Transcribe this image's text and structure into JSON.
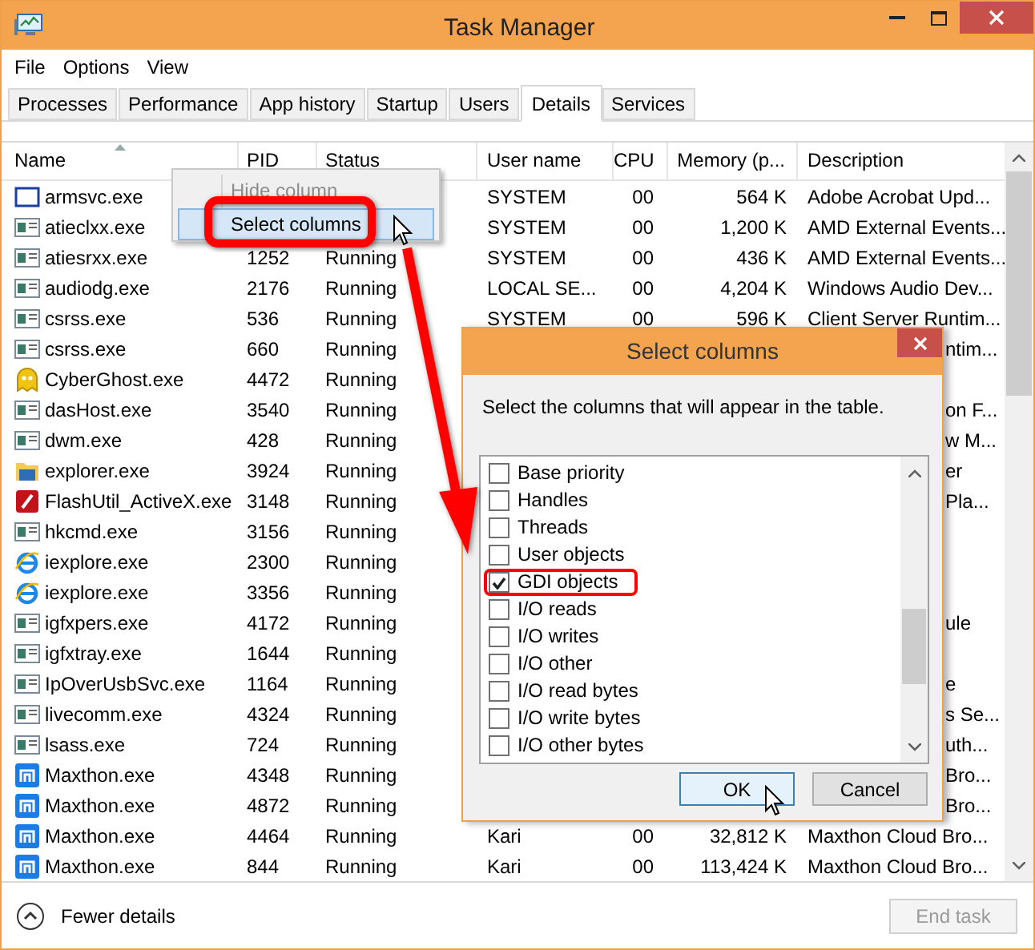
{
  "window": {
    "title": "Task Manager"
  },
  "menu": [
    "File",
    "Options",
    "View"
  ],
  "tabs": [
    {
      "label": "Processes",
      "selected": false
    },
    {
      "label": "Performance",
      "selected": false
    },
    {
      "label": "App history",
      "selected": false
    },
    {
      "label": "Startup",
      "selected": false
    },
    {
      "label": "Users",
      "selected": false
    },
    {
      "label": "Details",
      "selected": true
    },
    {
      "label": "Services",
      "selected": false
    }
  ],
  "table": {
    "columns": [
      {
        "label": "Name",
        "sorted": true
      },
      {
        "label": "PID",
        "sorted": false
      },
      {
        "label": "Status",
        "sorted": false
      },
      {
        "label": "User name",
        "sorted": false
      },
      {
        "label": "CPU",
        "sorted": false
      },
      {
        "label": "Memory (p...",
        "sorted": false
      },
      {
        "label": "Description",
        "sorted": false
      }
    ],
    "rows": [
      {
        "kind": "frame",
        "name": "armsvc.exe",
        "user": "SYSTEM",
        "cpu": "00",
        "memory": "564 K",
        "description": "Adobe Acrobat Upd..."
      },
      {
        "kind": "app",
        "name": "atieclxx.exe",
        "user": "SYSTEM",
        "cpu": "00",
        "memory": "1,200 K",
        "description": "AMD External Events..."
      },
      {
        "kind": "app",
        "name": "atiesrxx.exe",
        "pid": "1252",
        "status": "Running",
        "user": "SYSTEM",
        "cpu": "00",
        "memory": "436 K",
        "description": "AMD External Events..."
      },
      {
        "kind": "app",
        "name": "audiodg.exe",
        "pid": "2176",
        "status": "Running",
        "user": "LOCAL SE...",
        "cpu": "00",
        "memory": "4,204 K",
        "description": "Windows Audio Dev..."
      },
      {
        "kind": "app",
        "name": "csrss.exe",
        "pid": "536",
        "status": "Running",
        "user": "SYSTEM",
        "cpu": "00",
        "memory": "596 K",
        "description": "Client Server Runtim..."
      },
      {
        "kind": "app",
        "name": "csrss.exe",
        "pid": "660",
        "status": "Running",
        "description_tail": "ntim..."
      },
      {
        "kind": "ghost",
        "name": "CyberGhost.exe",
        "pid": "4472",
        "status": "Running"
      },
      {
        "kind": "app",
        "name": "dasHost.exe",
        "pid": "3540",
        "status": "Running",
        "description_tail": "on F..."
      },
      {
        "kind": "app",
        "name": "dwm.exe",
        "pid": "428",
        "status": "Running",
        "description_tail": "w M..."
      },
      {
        "kind": "folder",
        "name": "explorer.exe",
        "pid": "3924",
        "status": "Running",
        "description_tail": "er"
      },
      {
        "kind": "flash",
        "name": "FlashUtil_ActiveX.exe",
        "pid": "3148",
        "status": "Running",
        "description_tail": "Pla..."
      },
      {
        "kind": "app",
        "name": "hkcmd.exe",
        "pid": "3156",
        "status": "Running"
      },
      {
        "kind": "browser",
        "name": "iexplore.exe",
        "pid": "2300",
        "status": "Running"
      },
      {
        "kind": "browser",
        "name": "iexplore.exe",
        "pid": "3356",
        "status": "Running"
      },
      {
        "kind": "app",
        "name": "igfxpers.exe",
        "pid": "4172",
        "status": "Running",
        "description_tail": "ule"
      },
      {
        "kind": "app",
        "name": "igfxtray.exe",
        "pid": "1644",
        "status": "Running"
      },
      {
        "kind": "app",
        "name": "IpOverUsbSvc.exe",
        "pid": "1164",
        "status": "Running",
        "description_tail": "e"
      },
      {
        "kind": "app",
        "name": "livecomm.exe",
        "pid": "4324",
        "status": "Running",
        "description_tail": "s Se..."
      },
      {
        "kind": "app",
        "name": "lsass.exe",
        "pid": "724",
        "status": "Running",
        "description_tail": "uth..."
      },
      {
        "kind": "maxthon",
        "name": "Maxthon.exe",
        "pid": "4348",
        "status": "Running",
        "description_tail": "Bro..."
      },
      {
        "kind": "maxthon",
        "name": "Maxthon.exe",
        "pid": "4872",
        "status": "Running",
        "description_tail": "Bro..."
      },
      {
        "kind": "maxthon",
        "name": "Maxthon.exe",
        "pid": "4464",
        "status": "Running",
        "user": "Kari",
        "cpu": "00",
        "memory": "32,812 K",
        "description": "Maxthon Cloud Bro..."
      },
      {
        "kind": "maxthon",
        "name": "Maxthon.exe",
        "pid": "844",
        "status": "Running",
        "user": "Kari",
        "cpu": "00",
        "memory": "113,424 K",
        "description": "Maxthon Cloud Bro..."
      }
    ]
  },
  "context_menu": [
    {
      "label": "Hide column",
      "disabled": true,
      "selected": false
    },
    {
      "label": "Select columns",
      "disabled": false,
      "selected": true
    }
  ],
  "dialog": {
    "title": "Select columns",
    "instruction": "Select the columns that will appear in the table.",
    "options": [
      {
        "label": "Base priority",
        "checked": false,
        "highlighted": false
      },
      {
        "label": "Handles",
        "checked": false,
        "highlighted": false
      },
      {
        "label": "Threads",
        "checked": false,
        "highlighted": false
      },
      {
        "label": "User objects",
        "checked": false,
        "highlighted": false
      },
      {
        "label": "GDI objects",
        "checked": true,
        "highlighted": true
      },
      {
        "label": "I/O reads",
        "checked": false,
        "highlighted": false
      },
      {
        "label": "I/O writes",
        "checked": false,
        "highlighted": false
      },
      {
        "label": "I/O other",
        "checked": false,
        "highlighted": false
      },
      {
        "label": "I/O read bytes",
        "checked": false,
        "highlighted": false
      },
      {
        "label": "I/O write bytes",
        "checked": false,
        "highlighted": false
      },
      {
        "label": "I/O other bytes",
        "checked": false,
        "highlighted": false
      }
    ],
    "buttons": [
      {
        "label": "OK",
        "focused": true
      },
      {
        "label": "Cancel",
        "focused": false
      }
    ]
  },
  "footer": {
    "toggle": "Fewer details",
    "end_task": {
      "label": "End task",
      "disabled": true
    }
  }
}
